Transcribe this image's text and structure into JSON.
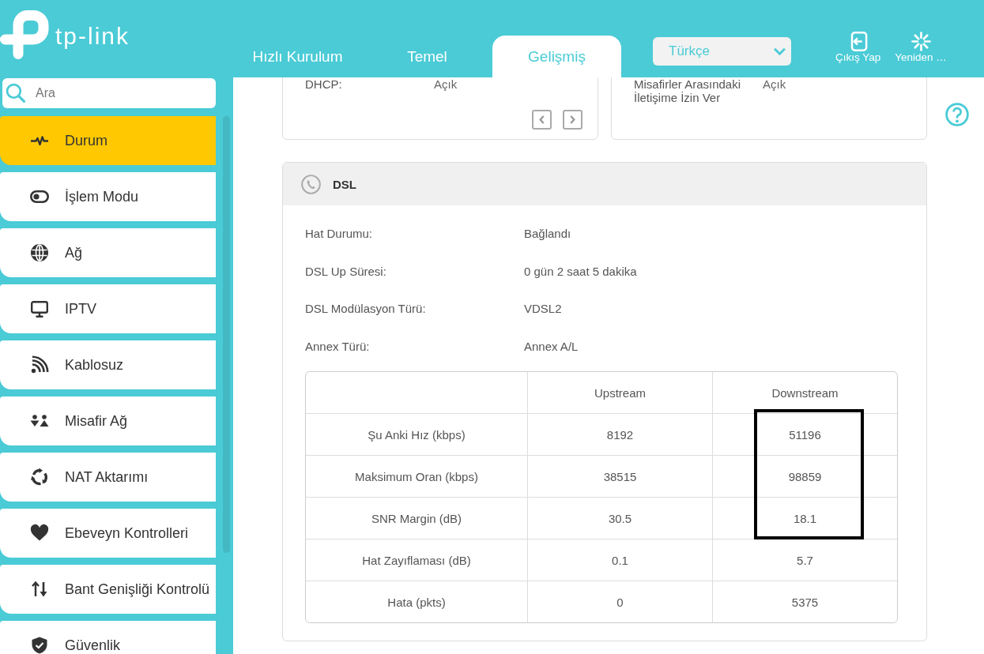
{
  "header": {
    "logo": "tp-link",
    "tabs": [
      {
        "label": "Hızlı Kurulum",
        "selected": false
      },
      {
        "label": "Temel",
        "selected": false
      },
      {
        "label": "Gelişmiş",
        "selected": true
      }
    ],
    "language": {
      "value": "Türkçe"
    },
    "actions": [
      {
        "kind": "logout",
        "label": "Çıkış Yap"
      },
      {
        "kind": "reboot",
        "label": "Yeniden …"
      }
    ]
  },
  "sidebar": {
    "search": {
      "placeholder": "Ara"
    },
    "items": [
      {
        "kind": "status",
        "label": "Durum",
        "selected": true
      },
      {
        "kind": "mode",
        "label": "İşlem Modu",
        "selected": false
      },
      {
        "kind": "network",
        "label": "Ağ",
        "selected": false
      },
      {
        "kind": "iptv",
        "label": "IPTV",
        "selected": false
      },
      {
        "kind": "wireless",
        "label": "Kablosuz",
        "selected": false
      },
      {
        "kind": "guest",
        "label": "Misafir Ağ",
        "selected": false
      },
      {
        "kind": "nat",
        "label": "NAT Aktarımı",
        "selected": false
      },
      {
        "kind": "parental",
        "label": "Ebeveyn Kontrolleri",
        "selected": false
      },
      {
        "kind": "bandwidth",
        "label": "Bant Genişliği Kontrolü",
        "selected": false
      },
      {
        "kind": "security",
        "label": "Güvenlik",
        "selected": false
      }
    ]
  },
  "cards": [
    {
      "rows": [
        {
          "label": "DHCP:",
          "value": "Açık"
        }
      ],
      "pager": true
    },
    {
      "rows": [
        {
          "label": "Misafirler Arasındaki İletişime İzin Ver",
          "value": "Açık"
        }
      ]
    }
  ],
  "dsl": {
    "title": "DSL",
    "rows": [
      {
        "label": "Hat Durumu:",
        "value": "Bağlandı"
      },
      {
        "label": "DSL Up Süresi:",
        "value": "0 gün 2 saat 5 dakika"
      },
      {
        "label": "DSL Modülasyon Türü:",
        "value": "VDSL2"
      },
      {
        "label": "Annex Türü:",
        "value": "Annex A/L"
      }
    ],
    "table": {
      "columns": [
        "Upstream",
        "Downstream"
      ],
      "rows": [
        {
          "label": "Şu Anki Hız (kbps)",
          "upstream": "8192",
          "downstream": "51196",
          "highlighted": true
        },
        {
          "label": "Maksimum Oran (kbps)",
          "upstream": "38515",
          "downstream": "98859",
          "highlighted": true
        },
        {
          "label": "SNR Margin (dB)",
          "upstream": "30.5",
          "downstream": "18.1",
          "highlighted": true
        },
        {
          "label": "Hat Zayıflaması (dB)",
          "upstream": "0.1",
          "downstream": "5.7",
          "highlighted": false
        },
        {
          "label": "Hata (pkts)",
          "upstream": "0",
          "downstream": "5375",
          "highlighted": false
        }
      ]
    }
  }
}
